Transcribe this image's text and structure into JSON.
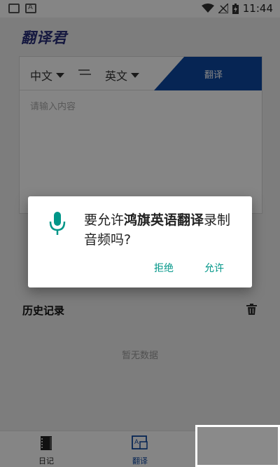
{
  "status_bar": {
    "time": "11:44"
  },
  "app": {
    "title": "翻译君"
  },
  "translator": {
    "source_lang": "中文",
    "target_lang": "英文",
    "swap_icon": "swap-arrows-icon",
    "translate_label": "翻译",
    "input_placeholder": "请输入内容"
  },
  "history": {
    "title": "历史记录",
    "empty_text": "暂无数据"
  },
  "bottom_nav": [
    {
      "label": "日记",
      "icon": "notebook-icon"
    },
    {
      "label": "翻译",
      "icon": "translate-icon",
      "active": true
    }
  ],
  "dialog": {
    "prefix": "要允许",
    "app_name": "鸿旗英语翻译",
    "suffix": "录制音频吗?",
    "deny_label": "拒绝",
    "allow_label": "允许"
  },
  "colors": {
    "accent": "#0d47a1",
    "dialog_button": "#009688",
    "mic": "#009688"
  }
}
